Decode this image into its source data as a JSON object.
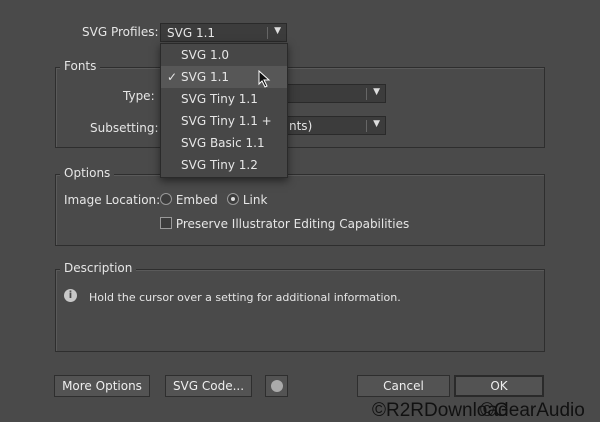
{
  "profiles": {
    "label": "SVG Profiles:",
    "value": "SVG 1.1",
    "options": [
      "SVG 1.0",
      "SVG 1.1",
      "SVG Tiny 1.1",
      "SVG Tiny 1.1 +",
      "SVG Basic 1.1",
      "SVG Tiny 1.2"
    ],
    "selected_index": 1,
    "check": "✓"
  },
  "fonts": {
    "title": "Fonts",
    "type_label": "Type:",
    "type_value": "",
    "subsetting_label": "Subsetting:",
    "subsetting_value_visible": "nts)"
  },
  "options": {
    "title": "Options",
    "image_location_label": "Image Location:",
    "embed_label": "Embed",
    "link_label": "Link",
    "image_location_selected": "Link",
    "preserve_label": "Preserve Illustrator Editing Capabilities",
    "preserve_checked": false
  },
  "description": {
    "title": "Description",
    "text": "Hold the cursor over a setting for additional information.",
    "icon": "info-icon"
  },
  "buttons": {
    "more_options": "More Options",
    "svg_code": "SVG Code...",
    "web": "globe-icon",
    "cancel": "Cancel",
    "ok": "OK"
  },
  "watermark": [
    "©R2RDownload",
    "©GearAudio"
  ]
}
